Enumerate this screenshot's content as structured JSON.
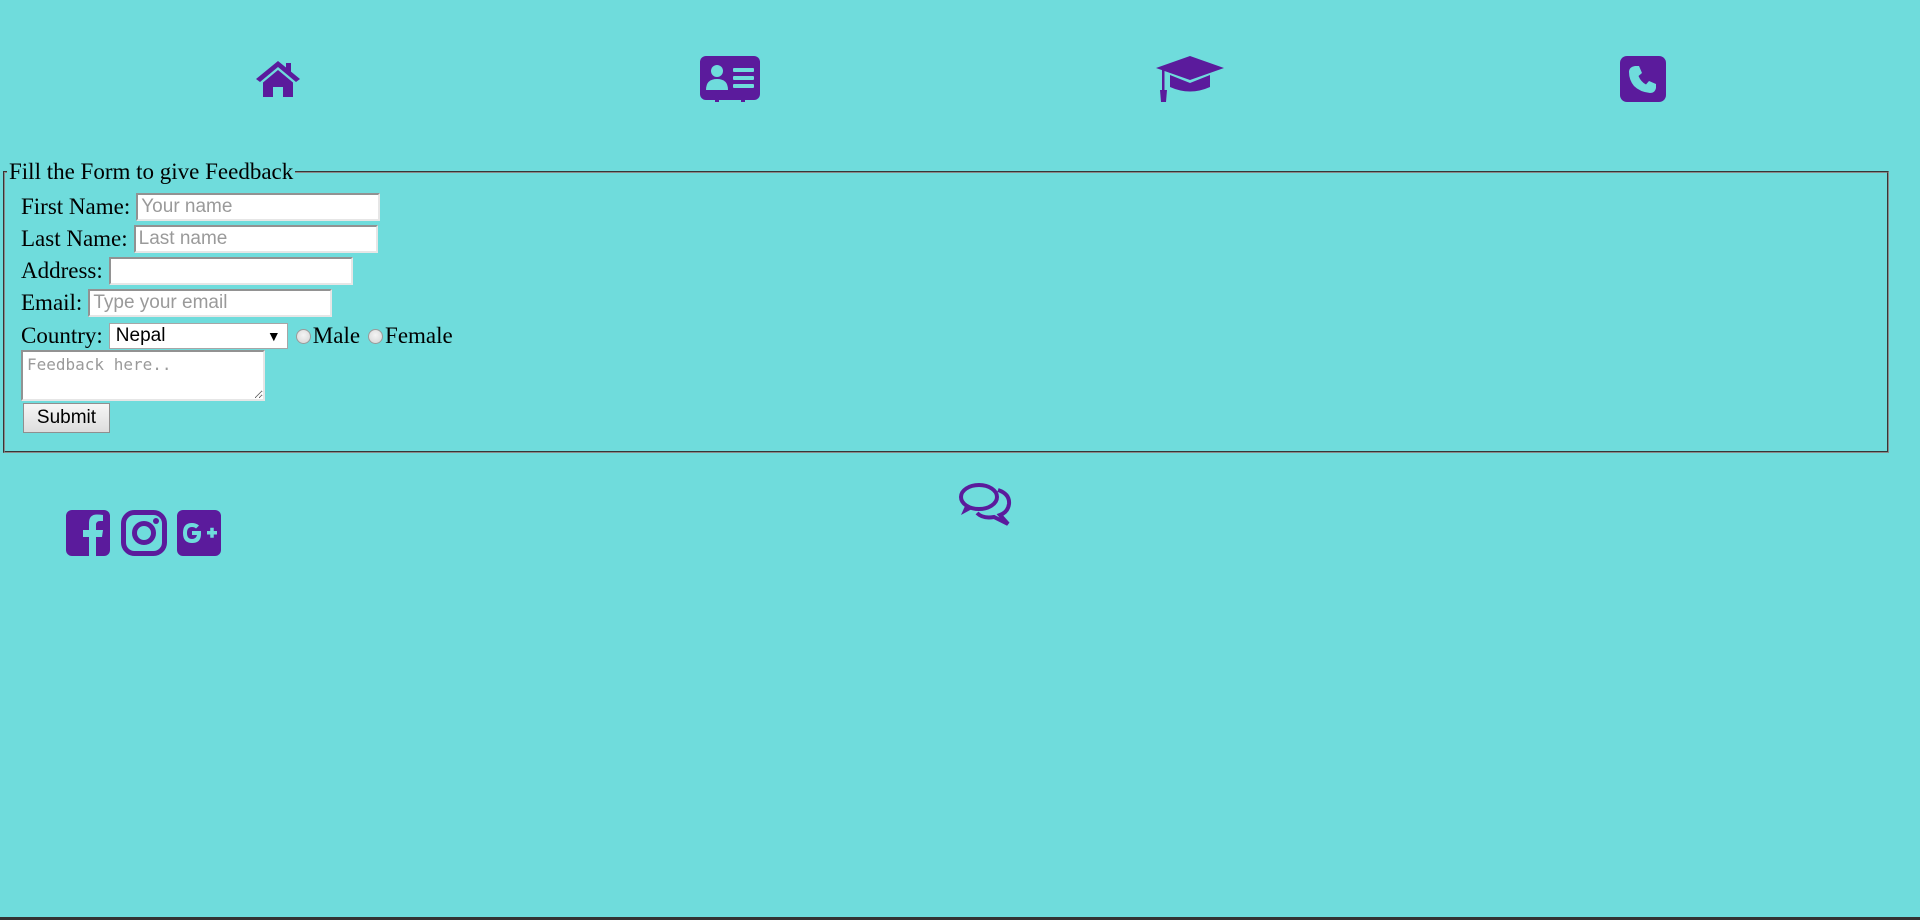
{
  "theme": {
    "background": "#6fdcdc",
    "accent": "#5b1b9c"
  },
  "nav": {
    "items": [
      {
        "icon": "home-icon"
      },
      {
        "icon": "id-card-icon"
      },
      {
        "icon": "graduation-cap-icon"
      },
      {
        "icon": "phone-icon"
      }
    ]
  },
  "form": {
    "legend": "Fill the Form to give Feedback",
    "first_name": {
      "label": "First Name:",
      "placeholder": "Your name",
      "value": ""
    },
    "last_name": {
      "label": "Last Name:",
      "placeholder": "Last name",
      "value": ""
    },
    "address": {
      "label": "Address:",
      "placeholder": "",
      "value": ""
    },
    "email": {
      "label": "Email:",
      "placeholder": "Type your email",
      "value": ""
    },
    "country": {
      "label": "Country:",
      "selected": "Nepal"
    },
    "gender": {
      "male_label": "Male",
      "female_label": "Female"
    },
    "feedback": {
      "placeholder": "Feedback here.."
    },
    "submit_label": "Submit"
  },
  "feedback_icon": "comments-icon",
  "social": {
    "items": [
      {
        "icon": "facebook-icon"
      },
      {
        "icon": "instagram-icon"
      },
      {
        "icon": "google-plus-icon"
      }
    ]
  }
}
